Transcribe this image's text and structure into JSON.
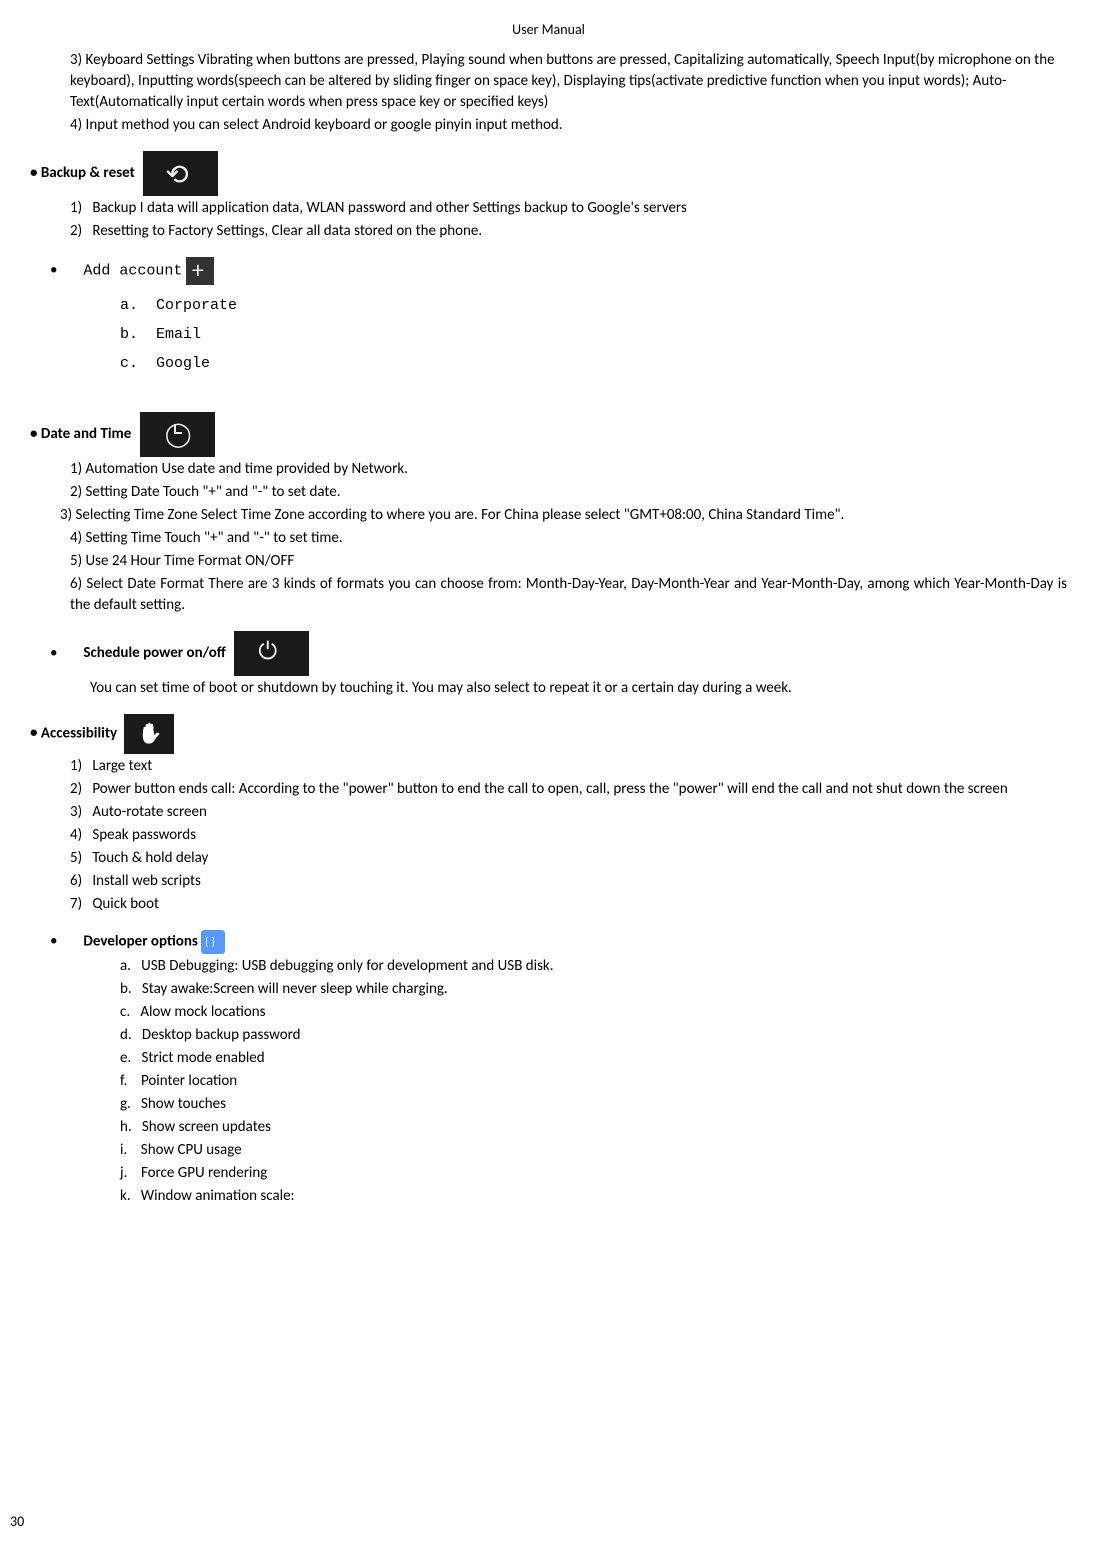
{
  "header": "User    Manual",
  "pageNum": "30",
  "intro": {
    "line3": "3) Keyboard Settings        Vibrating when buttons are pressed, Playing sound when buttons are pressed, Capitalizing automatically, Speech Input(by microphone on the keyboard), Inputting words(speech can be altered by sliding finger on space key), Displaying tips(activate predictive function when you input words); Auto-Text(Automatically input certain words when press space key or specified keys)",
    "line4": "4) Input method        you can select Android keyboard or google pinyin input method."
  },
  "backupReset": {
    "title": "Backup & reset",
    "items": [
      "Backup I data will application data, WLAN password and other Settings backup to Google's servers",
      "Resetting to Factory Settings, Clear all data stored on the phone."
    ]
  },
  "addAccount": {
    "title": "Add account",
    "items": [
      "Corporate",
      "Email",
      "Google"
    ]
  },
  "dateTime": {
    "title": "Date and Time",
    "items": [
      "1) Automation        Use date and time provided by Network.",
      "2) Setting Date        Touch \"+\" and \"-\" to set date.",
      "3) Selecting Time Zone        Select Time Zone according to where you are. For China please select \"GMT+08:00, China Standard Time\".",
      "4) Setting Time        Touch \"+\" and \"-\" to set time.",
      "5) Use 24 Hour Time Format        ON/OFF",
      "6) Select Date Format        There are 3 kinds of formats you can choose from: Month-Day-Year, Day-Month-Year and Year-Month-Day, among which Year-Month-Day is the default setting."
    ]
  },
  "schedule": {
    "title": "Schedule power on/off",
    "desc": "You can set time of boot or shutdown by touching it. You may also select to repeat it or a certain day during a week."
  },
  "accessibility": {
    "title": "Accessibility",
    "items": [
      "Large text",
      "Power button ends call: According to the \"power\" button to end the call to open, call, press the \"power\" will end the call and not shut down the screen",
      "Auto-rotate screen",
      "Speak passwords",
      "Touch & hold delay",
      "Install web scripts",
      "Quick boot"
    ]
  },
  "developer": {
    "title": "Developer    options",
    "items": [
      "USB Debugging: USB debugging only for development and USB disk.",
      "Stay awake:Screen will never sleep while charging.",
      "Alow mock locations",
      "Desktop backup password",
      "Strict mode enabled",
      "Pointer location",
      "Show touches",
      "Show screen updates",
      "Show   CPU usage",
      "Force GPU rendering",
      "Window animation scale:"
    ]
  }
}
